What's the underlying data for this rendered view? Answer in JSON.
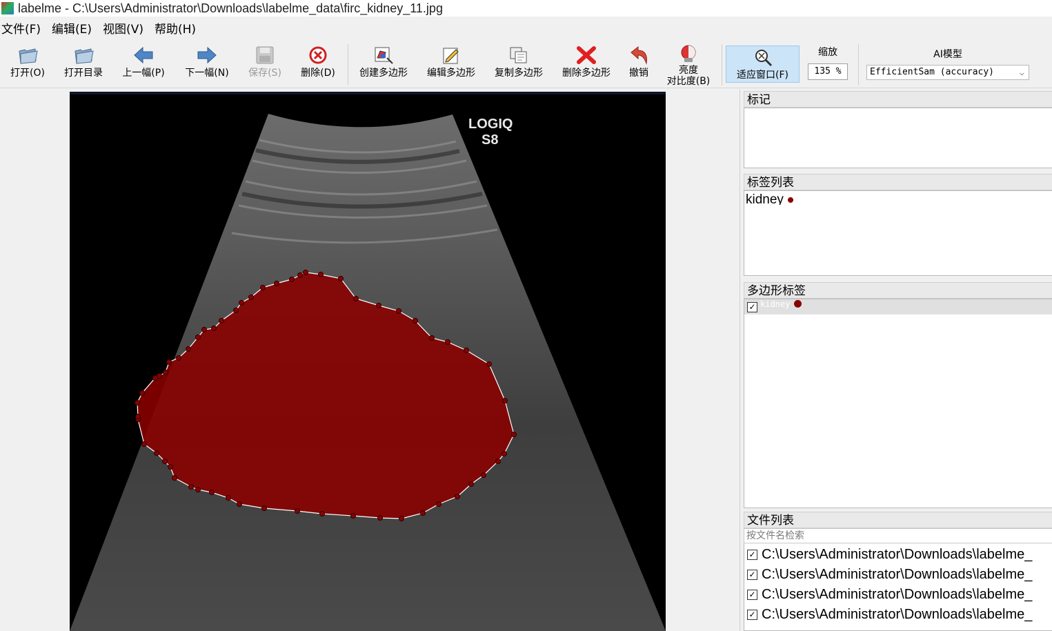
{
  "window": {
    "title": "labelme - C:\\Users\\Administrator\\Downloads\\labelme_data\\firc_kidney_11.jpg"
  },
  "menu": [
    "文件(F)",
    "编辑(E)",
    "视图(V)",
    "帮助(H)"
  ],
  "toolbar": {
    "open": "打开(O)",
    "open_dir": "打开目录",
    "prev": "上一幅(P)",
    "next": "下一幅(N)",
    "save": "保存(S)",
    "delete_file": "删除(D)",
    "create_polygon": "创建多边形",
    "edit_polygon": "编辑多边形",
    "copy_polygon": "复制多边形",
    "delete_polygon": "删除多边形",
    "undo": "撤销",
    "brightness_l1": "亮度",
    "brightness_l2": "对比度(B)",
    "fit_window": "适应窗口(F)",
    "zoom_label": "缩放",
    "zoom_value": "135 %",
    "ai_label": "AI模型",
    "ai_model": "EfficientSam (accuracy)"
  },
  "image": {
    "overlay_brand": "LOGIQ",
    "overlay_model": "S8"
  },
  "colors": {
    "polygon_fill": "#8b0000",
    "polygon_stroke": "#ffffff",
    "active_tool": "#cce4f7"
  },
  "panels": {
    "flags": {
      "title": "标记"
    },
    "label_list": {
      "title": "标签列表",
      "items": [
        "kidney"
      ]
    },
    "polygon_labels": {
      "title": "多边形标签",
      "items": [
        {
          "label": "kidney",
          "checked": true
        }
      ]
    },
    "file_list": {
      "title": "文件列表",
      "search_placeholder": "按文件名检索",
      "files": [
        "C:\\Users\\Administrator\\Downloads\\labelme_",
        "C:\\Users\\Administrator\\Downloads\\labelme_",
        "C:\\Users\\Administrator\\Downloads\\labelme_",
        "C:\\Users\\Administrator\\Downloads\\labelme_"
      ]
    }
  }
}
